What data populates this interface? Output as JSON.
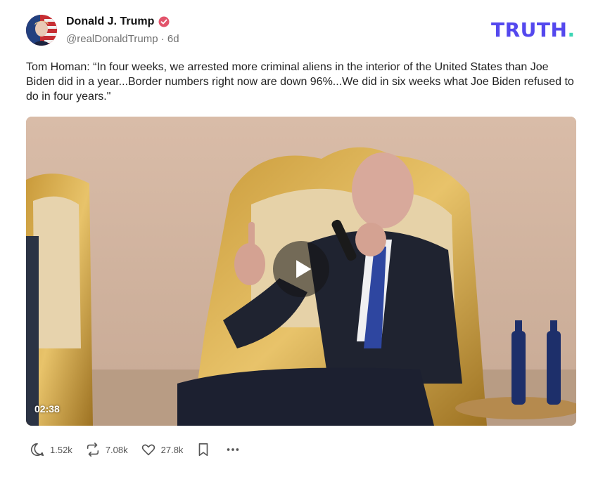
{
  "author": {
    "display_name": "Donald J. Trump",
    "handle": "@realDonaldTrump",
    "separator": "·",
    "time_ago": "6d"
  },
  "brand": {
    "name": "TRUTH",
    "dot": "."
  },
  "post": {
    "text": "Tom Homan: “In four weeks, we arrested more criminal aliens in the interior of the United States than Joe Biden did in a year...Border numbers right now are down 96%...We did in six weeks what Joe Biden refused to do in four years.\""
  },
  "video": {
    "duration": "02:38",
    "play_icon": "play-icon"
  },
  "actions": {
    "replies": "1.52k",
    "retruths": "7.08k",
    "likes": "27.8k"
  },
  "colors": {
    "brand": "#5448ee",
    "brand_dot": "#3dd6b5",
    "verified": "#e2546b"
  }
}
